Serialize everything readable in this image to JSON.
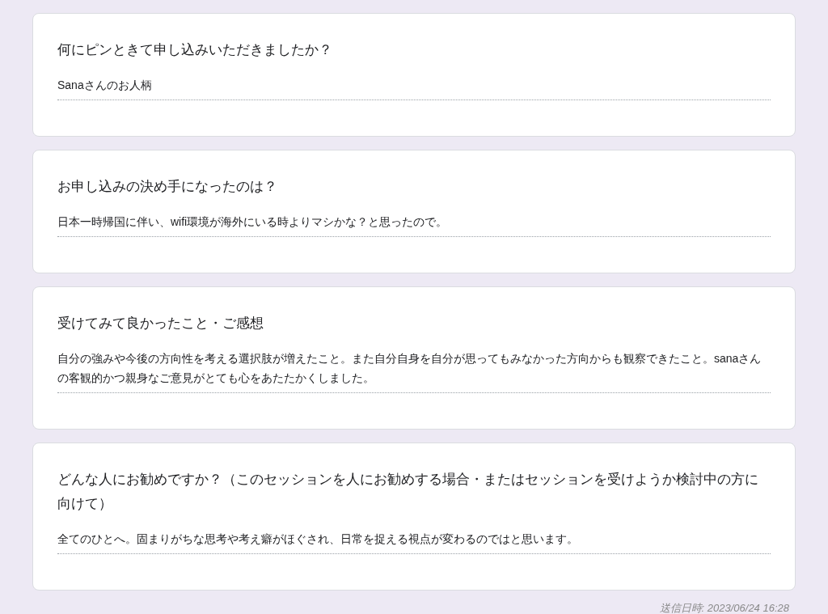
{
  "responses": [
    {
      "question": "何にピンときて申し込みいただきましたか？",
      "answer": "Sanaさんのお人柄"
    },
    {
      "question": "お申し込みの決め手になったのは？",
      "answer": "日本一時帰国に伴い、wifi環境が海外にいる時よりマシかな？と思ったので。"
    },
    {
      "question": "受けてみて良かったこと・ご感想",
      "answer": "自分の強みや今後の方向性を考える選択肢が増えたこと。また自分自身を自分が思ってもみなかった方向からも観察できたこと。sanaさんの客観的かつ親身なご意見がとても心をあたたかくしました。"
    },
    {
      "question": "どんな人にお勧めですか？（このセッションを人にお勧めする場合・またはセッションを受けようか検討中の方に向けて）",
      "answer": "全てのひとへ。固まりがちな思考や考え癖がほぐされ、日常を捉える視点が変わるのではと思います。"
    }
  ],
  "timestamp": "送信日時: 2023/06/24 16:28"
}
